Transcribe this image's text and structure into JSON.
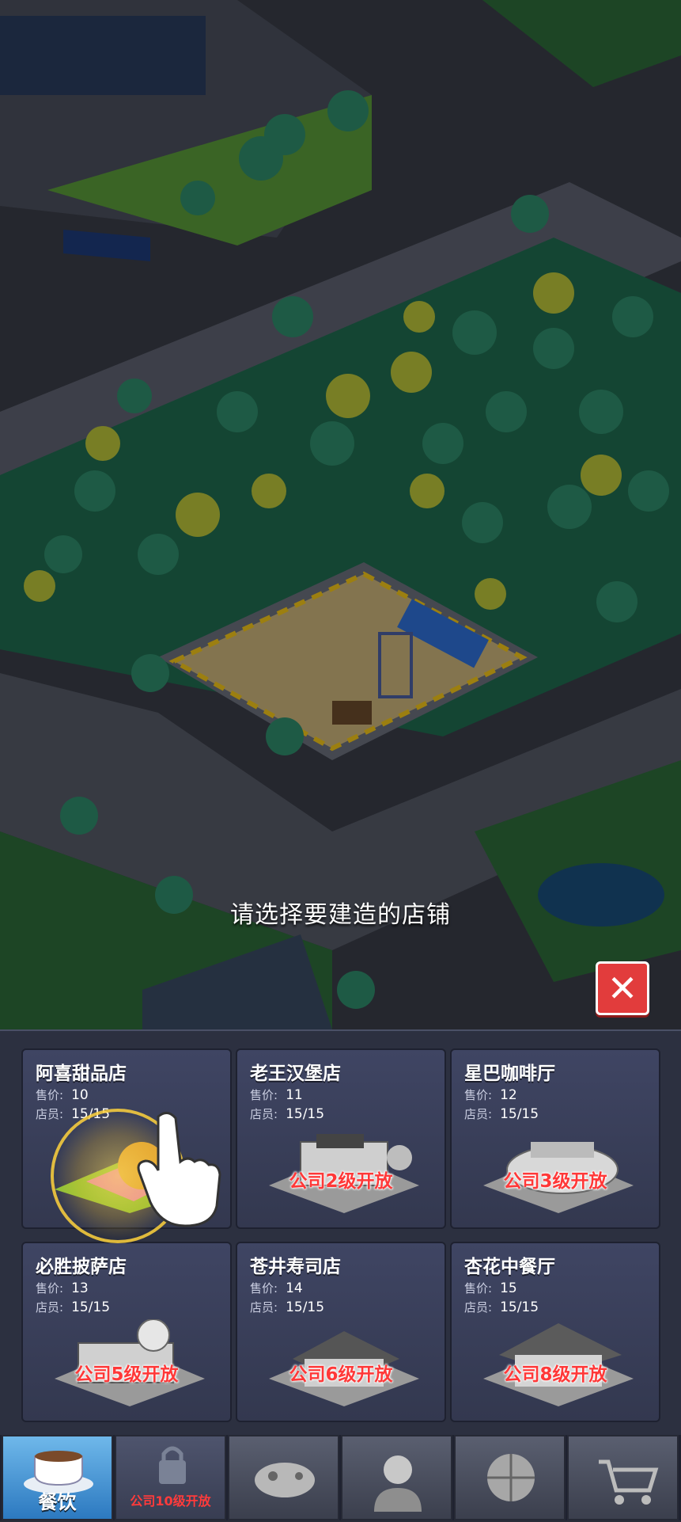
{
  "prompt": "请选择要建造的店铺",
  "close_icon": "close-x-icon",
  "shops": [
    {
      "name": "阿喜甜品店",
      "price_label": "售价:",
      "price": "10",
      "staff_label": "店员:",
      "staff": "15/15",
      "lock_text": "",
      "locked": false
    },
    {
      "name": "老王汉堡店",
      "price_label": "售价:",
      "price": "11",
      "staff_label": "店员:",
      "staff": "15/15",
      "lock_text": "公司2级开放",
      "locked": true
    },
    {
      "name": "星巴咖啡厅",
      "price_label": "售价:",
      "price": "12",
      "staff_label": "店员:",
      "staff": "15/15",
      "lock_text": "公司3级开放",
      "locked": true
    },
    {
      "name": "必胜披萨店",
      "price_label": "售价:",
      "price": "13",
      "staff_label": "店员:",
      "staff": "15/15",
      "lock_text": "公司5级开放",
      "locked": true
    },
    {
      "name": "苍井寿司店",
      "price_label": "售价:",
      "price": "14",
      "staff_label": "店员:",
      "staff": "15/15",
      "lock_text": "公司6级开放",
      "locked": true
    },
    {
      "name": "杏花中餐厅",
      "price_label": "售价:",
      "price": "15",
      "staff_label": "店员:",
      "staff": "15/15",
      "lock_text": "公司8级开放",
      "locked": true
    }
  ],
  "tabs": [
    {
      "label": "餐饮",
      "icon": "coffee-cup-icon",
      "active": true
    },
    {
      "label": "公司10级开放",
      "icon": "lock-icon",
      "active": false
    },
    {
      "label": "",
      "icon": "gamepad-icon",
      "active": false
    },
    {
      "label": "",
      "icon": "customer-service-icon",
      "active": false
    },
    {
      "label": "",
      "icon": "basketball-icon",
      "active": false
    },
    {
      "label": "",
      "icon": "shopping-cart-icon",
      "active": false
    }
  ],
  "colors": {
    "accent": "#2c79c0",
    "lock_red": "#ff3838",
    "close_red": "#e23c3c",
    "grass": "#1f6b4f"
  }
}
